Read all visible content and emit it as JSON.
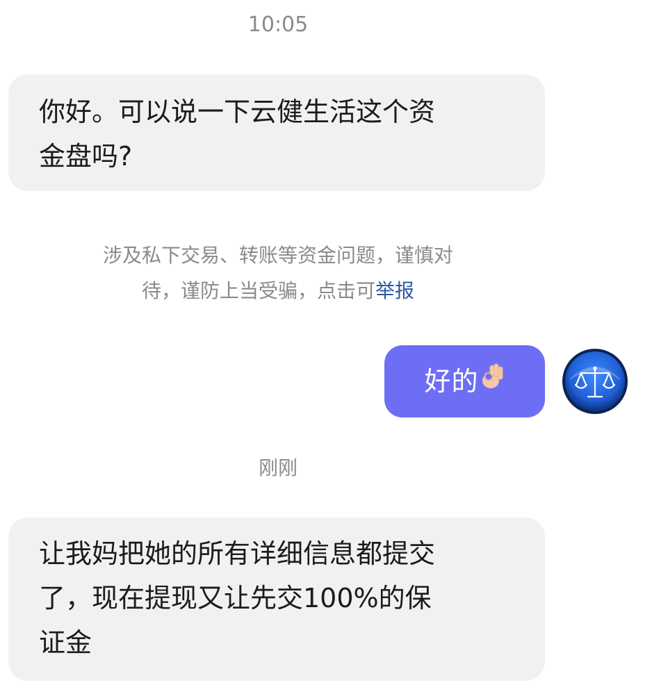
{
  "chat": {
    "timestamp_top": "10:05",
    "message_1": {
      "line_1": "你好。可以说一下云健生活这个资",
      "line_2": "金盘吗?"
    },
    "notice": {
      "line_1": "涉及私下交易、转账等资金问题，谨慎对",
      "line_2_prefix": "待，谨防上当受骗，点击可",
      "link_text": "举报"
    },
    "reply": {
      "text": "好的",
      "emoji_icon": "ok-hand-emoji-icon"
    },
    "avatar_icon": "scales-of-justice-icon",
    "timestamp_mid": "刚刚",
    "message_2": {
      "line_1": "让我妈把她的所有详细信息都提交",
      "line_2": "了，现在提现又让先交100%的保",
      "line_3": "证金"
    }
  },
  "colors": {
    "incoming_bubble": "#f1f1f1",
    "outgoing_bubble": "#6e6ef4",
    "timestamp_text": "#8a8a8a",
    "link": "#2e57a4",
    "avatar_blue": "#1f5fd6"
  }
}
